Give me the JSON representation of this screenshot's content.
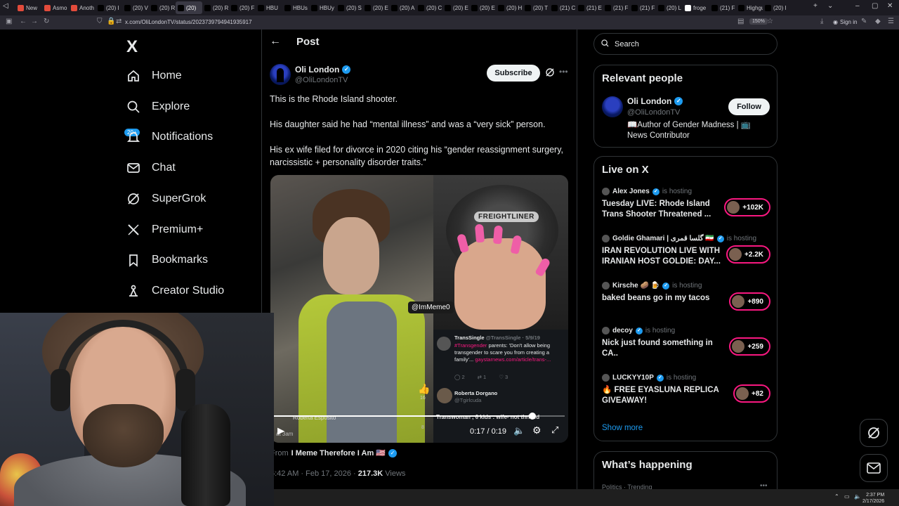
{
  "browser": {
    "tabs": [
      {
        "label": "New",
        "color": "#e24b3b"
      },
      {
        "label": "Asmo",
        "color": "#e24b3b"
      },
      {
        "label": "Anoth",
        "color": "#e24b3b"
      },
      {
        "label": "(20) I",
        "color": "#000000"
      },
      {
        "label": "(20) V",
        "color": "#000000"
      },
      {
        "label": "(20) R",
        "color": "#000000"
      },
      {
        "label": "(20)",
        "color": "#000000",
        "active": true
      },
      {
        "label": "(20) R",
        "color": "#000000"
      },
      {
        "label": "(20) F",
        "color": "#000000"
      },
      {
        "label": "HBU",
        "color": "#000000"
      },
      {
        "label": "HBUs",
        "color": "#000000"
      },
      {
        "label": "HBUy",
        "color": "#000000"
      },
      {
        "label": "(20) S",
        "color": "#000000"
      },
      {
        "label": "(20) E",
        "color": "#000000"
      },
      {
        "label": "(20) A",
        "color": "#000000"
      },
      {
        "label": "(20) C",
        "color": "#000000"
      },
      {
        "label": "(20) E",
        "color": "#000000"
      },
      {
        "label": "(20) E",
        "color": "#000000"
      },
      {
        "label": "(20) H",
        "color": "#000000"
      },
      {
        "label": "(20) T",
        "color": "#000000"
      },
      {
        "label": "(21) C",
        "color": "#000000"
      },
      {
        "label": "(21) E",
        "color": "#000000"
      },
      {
        "label": "(21) F",
        "color": "#000000"
      },
      {
        "label": "(21) F",
        "color": "#000000"
      },
      {
        "label": "(20) L",
        "color": "#000000"
      },
      {
        "label": "froge",
        "color": "#ffffff"
      },
      {
        "label": "(21) F",
        "color": "#000000"
      },
      {
        "label": "Highguar",
        "color": "#000000"
      },
      {
        "label": "(20) I",
        "color": "#000000"
      }
    ],
    "url": "x.com/OliLondonTV/status/2023739794941935917",
    "zoom": "150%",
    "sign_in": "Sign in"
  },
  "sidebar": {
    "logo": "X",
    "notifications_badge": "20+",
    "items": [
      {
        "label": "Home",
        "icon": "home-icon"
      },
      {
        "label": "Explore",
        "icon": "search-icon"
      },
      {
        "label": "Notifications",
        "icon": "bell-icon"
      },
      {
        "label": "Chat",
        "icon": "mail-icon"
      },
      {
        "label": "SuperGrok",
        "icon": "grok-icon"
      },
      {
        "label": "Premium+",
        "icon": "x-icon"
      },
      {
        "label": "Bookmarks",
        "icon": "bookmark-icon"
      },
      {
        "label": "Creator Studio",
        "icon": "creator-icon"
      }
    ]
  },
  "post": {
    "header_title": "Post",
    "author_name": "Oli London",
    "author_handle": "@OliLondonTV",
    "subscribe_label": "Subscribe",
    "paragraphs": [
      "This is the Rhode Island shooter.",
      "His daughter said he had “mental illness” and was a “very sick” person.",
      "His ex wife filed for divorce in 2020 citing his “gender reassignment surgery, narcissistic + personality disorder traits.”"
    ],
    "media": {
      "steering_text": "FREIGHTLINER",
      "watermark": "@ImMeme0",
      "embedded_tweet_user": "TransSingle",
      "embedded_tweet_handle": "@TransSingle · 5/9/19",
      "embedded_tweet_hashtag": "#Transgender",
      "embedded_tweet_text": " parents: 'Don't allow being transgender to scare you from creating a family'... ",
      "embedded_tweet_link": "gaystarnews.com/article/trans-...",
      "embedded_tweet_counts": [
        "2",
        "1",
        "3"
      ],
      "reply_name": "Roberta Dorgano",
      "reply_handle": "@Tgirlcuda",
      "like_count": "16",
      "overlay_name": "Roberta Esposito",
      "overlay_time": "at 3am",
      "overlay_caption": "Transwoman , 6 kids : wife- not thrilled",
      "overlay_count": "8",
      "time": "0:17 / 0:19",
      "progress": 0.89
    },
    "from_label": "From",
    "from_source": "I Meme Therefore I Am 🇺🇸",
    "timestamp": "6:42 AM · Feb 17, 2026 · ",
    "views_count": "217.3K",
    "views_label": " Views"
  },
  "right": {
    "search_placeholder": "Search",
    "relevant_title": "Relevant people",
    "relevant": {
      "name": "Oli London",
      "handle": "@OliLondonTV",
      "bio": "📖Author of Gender Madness | 📺 News Contributor",
      "follow_label": "Follow"
    },
    "live_title": "Live on X",
    "live": [
      {
        "host": "Alex Jones",
        "hosting": "is hosting",
        "title": "Tuesday LIVE: Rhode Island Trans Shooter Threatened ...",
        "count": "+102K"
      },
      {
        "host": "Goldie Ghamari | گلسا قمری 🇮🇷",
        "hosting": "is hosting",
        "title": "IRAN REVOLUTION LIVE WITH IRANIAN HOST GOLDIE: DAY...",
        "count": "+2.2K"
      },
      {
        "host": "Kirsche 🥔 🍺",
        "hosting": "is hosting",
        "title": "baked beans go in my tacos",
        "count": "+890"
      },
      {
        "host": "decoy",
        "hosting": "is hosting",
        "title": "Nick just found something in CA..",
        "count": "+259"
      },
      {
        "host": "LUCKYY10P",
        "hosting": "is hosting",
        "title": "🔥 FREE EYASLUNA REPLICA GIVEAWAY!",
        "count": "+82"
      }
    ],
    "show_more": "Show more",
    "whats_happening": "What’s happening",
    "trending_category": "Politics · Trending"
  },
  "taskbar": {
    "time": "2:37 PM",
    "date": "2/17/2026"
  },
  "colors": {
    "accent": "#1d9bf0",
    "live_ring": "#f91880",
    "background": "#000000"
  }
}
